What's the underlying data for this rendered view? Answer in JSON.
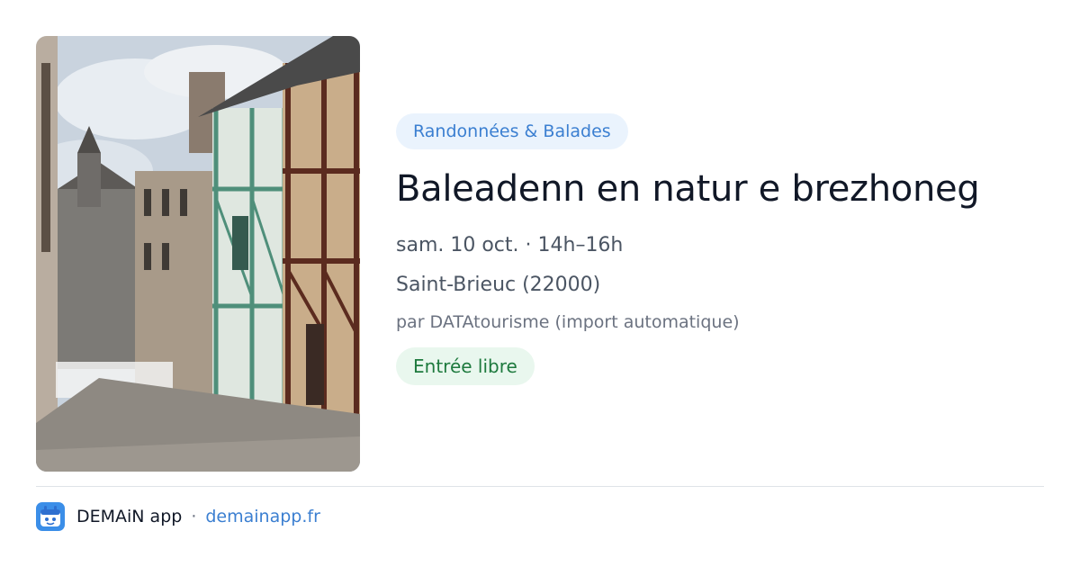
{
  "event": {
    "image_alt": "Rue pavée bordée de maisons à colombages",
    "category": "Randonnées & Balades",
    "title": "Baleadenn en natur e brezhoneg",
    "datetime": "sam. 10 oct. · 14h–16h",
    "location": "Saint-Brieuc (22000)",
    "organizer": "par DATAtourisme (import automatique)",
    "price": "Entrée libre"
  },
  "footer": {
    "app_icon": "demain-app-icon",
    "app_name": "DEMAiN app",
    "separator": "·",
    "site": "demainapp.fr"
  },
  "colors": {
    "accent": "#3b7fd1",
    "category_bg": "#eaf3fd",
    "price_bg": "#e9f7ee",
    "price_text": "#1e7a3e",
    "title": "#111827"
  }
}
